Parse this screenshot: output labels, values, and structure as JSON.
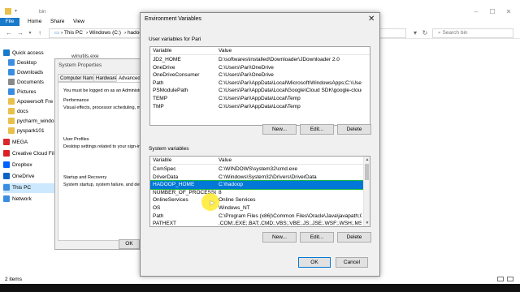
{
  "explorer": {
    "title": "bin",
    "ribbon_tabs": [
      "File",
      "Home",
      "Share",
      "View"
    ],
    "breadcrumb": [
      "This PC",
      "Windows (C:)",
      "hadoop"
    ],
    "search_placeholder": "Search bin",
    "visible_file": "winutils.exe",
    "sidebar": [
      {
        "label": "Quick access",
        "icon": "star-icon",
        "color": "#1979ca"
      },
      {
        "label": "Desktop",
        "icon": "desktop-icon",
        "color": "#3a8de0"
      },
      {
        "label": "Downloads",
        "icon": "download-icon",
        "color": "#3a8de0"
      },
      {
        "label": "Documents",
        "icon": "document-icon",
        "color": "#8a8a8a"
      },
      {
        "label": "Pictures",
        "icon": "pictures-icon",
        "color": "#3a8de0"
      },
      {
        "label": "Apowersoft Fre",
        "icon": "folder-icon",
        "color": "#e8c04a"
      },
      {
        "label": "docs",
        "icon": "folder-icon",
        "color": "#e8c04a"
      },
      {
        "label": "pycharm_windo",
        "icon": "folder-icon",
        "color": "#e8c04a"
      },
      {
        "label": "pyspark101",
        "icon": "folder-icon",
        "color": "#e8c04a"
      },
      {
        "label": "MEGA",
        "icon": "mega-icon",
        "color": "#d9272e"
      },
      {
        "label": "Creative Cloud Fil",
        "icon": "creative-cloud-icon",
        "color": "#da1f26"
      },
      {
        "label": "Dropbox",
        "icon": "dropbox-icon",
        "color": "#0061fe"
      },
      {
        "label": "OneDrive",
        "icon": "onedrive-icon",
        "color": "#0a64c8"
      },
      {
        "label": "This PC",
        "icon": "computer-icon",
        "color": "#3a8de0"
      },
      {
        "label": "Network",
        "icon": "network-icon",
        "color": "#3a8de0"
      }
    ],
    "status": "2 items"
  },
  "sysprops": {
    "title": "System Properties",
    "tabs": [
      "Computer Name",
      "Hardware",
      "Advanced",
      "S"
    ],
    "texts": [
      "You must be logged on as an Administra",
      "Performance",
      "Visual effects, processor scheduling, m",
      "User Profiles",
      "Desktop settings related to your sign-in",
      "Startup and Recovery",
      "System startup, system failure, and deb"
    ],
    "ok_label": "OK"
  },
  "env": {
    "title": "Environment Variables",
    "user_label": "User variables for Pari",
    "col_variable": "Variable",
    "col_value": "Value",
    "user_vars": [
      {
        "name": "JD2_HOME",
        "value": "D:\\softwares\\installed\\Downloader\\JDownloader 2.0"
      },
      {
        "name": "OneDrive",
        "value": "C:\\Users\\Pari\\OneDrive"
      },
      {
        "name": "OneDriveConsumer",
        "value": "C:\\Users\\Pari\\OneDrive"
      },
      {
        "name": "Path",
        "value": "C:\\Users\\Pari\\AppData\\Local\\Microsoft\\WindowsApps;C:\\Users\\..."
      },
      {
        "name": "PSModulePath",
        "value": "C:\\Users\\Pari\\AppData\\Local\\Google\\Cloud SDK\\google-cloud-..."
      },
      {
        "name": "TEMP",
        "value": "C:\\Users\\Pari\\AppData\\Local\\Temp"
      },
      {
        "name": "TMP",
        "value": "C:\\Users\\Pari\\AppData\\Local\\Temp"
      }
    ],
    "system_label": "System variables",
    "system_vars": [
      {
        "name": "ComSpec",
        "value": "C:\\WINDOWS\\system32\\cmd.exe"
      },
      {
        "name": "DriverData",
        "value": "C:\\Windows\\System32\\Drivers\\DriverData"
      },
      {
        "name": "HADOOP_HOME",
        "value": "C:\\hadoop",
        "selected": true
      },
      {
        "name": "NUMBER_OF_PROCESSORS",
        "value": "8"
      },
      {
        "name": "OnlineServices",
        "value": "Online Services"
      },
      {
        "name": "OS",
        "value": "Windows_NT"
      },
      {
        "name": "Path",
        "value": "C:\\Program Files (x86)\\Common Files\\Oracle\\Java\\javapath;C:\\wi..."
      },
      {
        "name": "PATHEXT",
        "value": ".COM;.EXE;.BAT;.CMD;.VBS;.VBE;.JS;.JSE;.WSF;.WSH;.MSC"
      }
    ],
    "buttons": {
      "new": "New...",
      "edit": "Edit...",
      "delete": "Delete",
      "ok": "OK",
      "cancel": "Cancel"
    }
  }
}
